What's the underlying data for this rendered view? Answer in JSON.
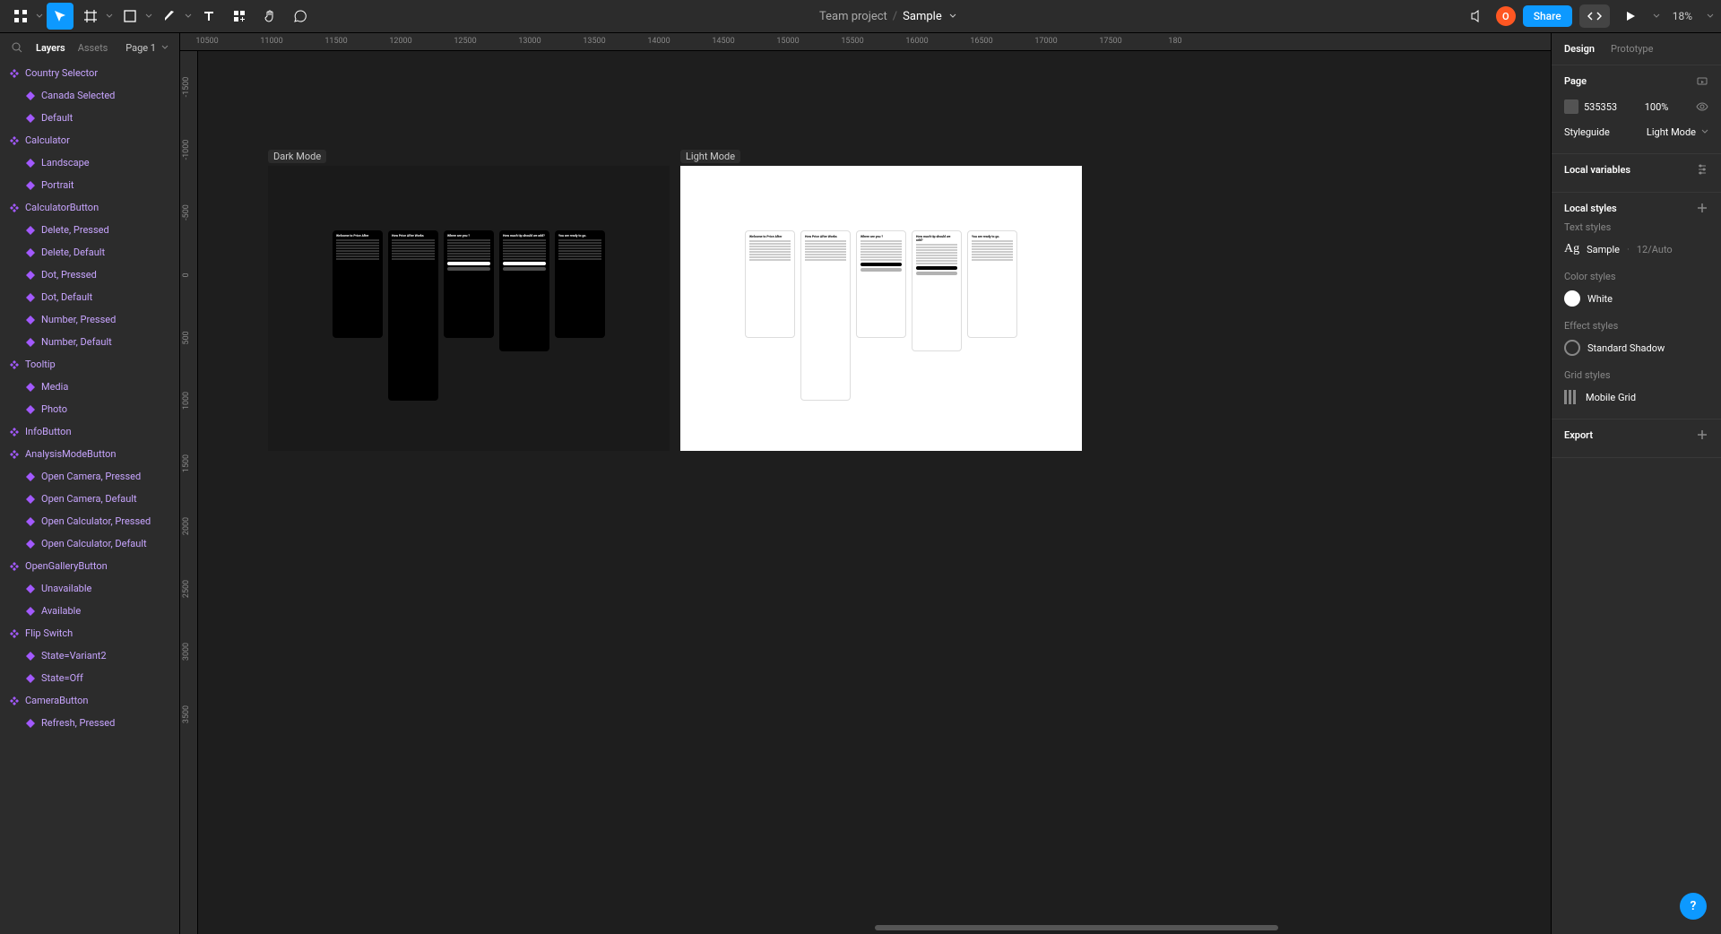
{
  "toolbar": {
    "project": "Team project",
    "separator": "/",
    "file": "Sample",
    "share": "Share",
    "avatar_initial": "O",
    "zoom": "18%"
  },
  "left_panel": {
    "tab_layers": "Layers",
    "tab_assets": "Assets",
    "page_label": "Page 1"
  },
  "layers": [
    {
      "type": "component",
      "label": "Country Selector",
      "depth": 0
    },
    {
      "type": "variant",
      "label": "Canada Selected",
      "depth": 1
    },
    {
      "type": "variant",
      "label": "Default",
      "depth": 1
    },
    {
      "type": "component",
      "label": "Calculator",
      "depth": 0
    },
    {
      "type": "variant",
      "label": "Landscape",
      "depth": 1
    },
    {
      "type": "variant",
      "label": "Portrait",
      "depth": 1
    },
    {
      "type": "component",
      "label": "CalculatorButton",
      "depth": 0
    },
    {
      "type": "variant",
      "label": "Delete, Pressed",
      "depth": 1
    },
    {
      "type": "variant",
      "label": "Delete, Default",
      "depth": 1
    },
    {
      "type": "variant",
      "label": "Dot, Pressed",
      "depth": 1
    },
    {
      "type": "variant",
      "label": "Dot, Default",
      "depth": 1
    },
    {
      "type": "variant",
      "label": "Number, Pressed",
      "depth": 1
    },
    {
      "type": "variant",
      "label": "Number, Default",
      "depth": 1
    },
    {
      "type": "component",
      "label": "Tooltip",
      "depth": 0
    },
    {
      "type": "variant",
      "label": "Media",
      "depth": 1
    },
    {
      "type": "variant",
      "label": "Photo",
      "depth": 1
    },
    {
      "type": "component",
      "label": "InfoButton",
      "depth": 0
    },
    {
      "type": "component",
      "label": "AnalysisModeButton",
      "depth": 0
    },
    {
      "type": "variant",
      "label": "Open Camera, Pressed",
      "depth": 1
    },
    {
      "type": "variant",
      "label": "Open Camera, Default",
      "depth": 1
    },
    {
      "type": "variant",
      "label": "Open Calculator, Pressed",
      "depth": 1
    },
    {
      "type": "variant",
      "label": "Open Calculator, Default",
      "depth": 1
    },
    {
      "type": "component",
      "label": "OpenGalleryButton",
      "depth": 0
    },
    {
      "type": "variant",
      "label": "Unavailable",
      "depth": 1
    },
    {
      "type": "variant",
      "label": "Available",
      "depth": 1
    },
    {
      "type": "component",
      "label": "Flip Switch",
      "depth": 0
    },
    {
      "type": "variant",
      "label": "State=Variant2",
      "depth": 1
    },
    {
      "type": "variant",
      "label": "State=Off",
      "depth": 1
    },
    {
      "type": "component",
      "label": "CameraButton",
      "depth": 0
    },
    {
      "type": "variant",
      "label": "Refresh, Pressed",
      "depth": 1
    }
  ],
  "canvas": {
    "ruler_h": [
      "10500",
      "11000",
      "11500",
      "12000",
      "12500",
      "13000",
      "13500",
      "14000",
      "14500",
      "15000",
      "15500",
      "16000",
      "16500",
      "17000",
      "17500",
      "180"
    ],
    "ruler_v": [
      "-1500",
      "-1000",
      "-500",
      "0",
      "500",
      "1000",
      "1500",
      "2000",
      "2500",
      "3000",
      "3500"
    ],
    "frames": {
      "dark": {
        "label": "Dark Mode"
      },
      "light": {
        "label": "Light Mode"
      }
    },
    "mock_titles": [
      "Welcome to Price After",
      "How Price After Works",
      "Where are you ?",
      "How much tip should we add?",
      "You are ready to go."
    ]
  },
  "right_panel": {
    "tab_design": "Design",
    "tab_prototype": "Prototype",
    "page_label": "Page",
    "page_color": "535353",
    "page_opacity": "100%",
    "styleguide_label": "Styleguide",
    "styleguide_value": "Light Mode",
    "local_variables": "Local variables",
    "local_styles": "Local styles",
    "text_styles": "Text styles",
    "text_sample_name": "Sample",
    "text_sample_meta": "12/Auto",
    "color_styles": "Color styles",
    "color_white": "White",
    "effect_styles": "Effect styles",
    "effect_shadow": "Standard Shadow",
    "grid_styles": "Grid styles",
    "grid_mobile": "Mobile Grid",
    "export": "Export"
  }
}
